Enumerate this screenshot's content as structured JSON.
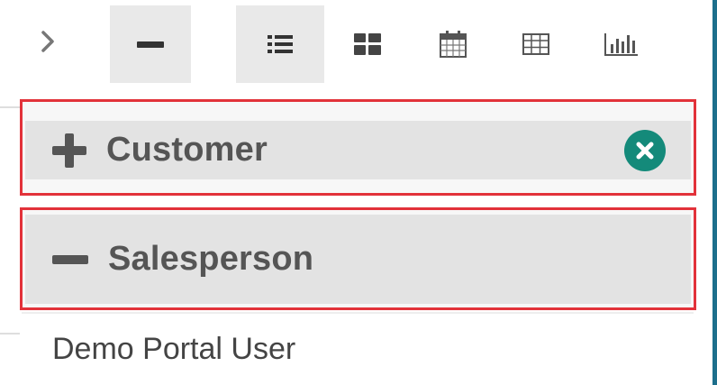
{
  "toolbar": {
    "expand_icon": "chevron-right-icon",
    "collapse_icon": "minus-icon",
    "views": [
      {
        "icon": "list-view-icon",
        "active": true
      },
      {
        "icon": "kanban-view-icon",
        "active": false
      },
      {
        "icon": "calendar-view-icon",
        "active": false
      },
      {
        "icon": "pivot-view-icon",
        "active": false
      },
      {
        "icon": "graph-view-icon",
        "active": false
      }
    ]
  },
  "groups": [
    {
      "label": "Customer",
      "state": "collapsed",
      "icon": "plus-icon",
      "removable": true,
      "remove_icon": "remove-circle-icon"
    },
    {
      "label": "Salesperson",
      "state": "expanded",
      "icon": "minus-icon"
    }
  ],
  "records": [
    {
      "name": "Demo Portal User"
    }
  ],
  "colors": {
    "highlight_border": "#e2323a",
    "remove_button": "#148a7a",
    "group_background": "#e3e3e3",
    "active_button": "#e9e9e9"
  }
}
